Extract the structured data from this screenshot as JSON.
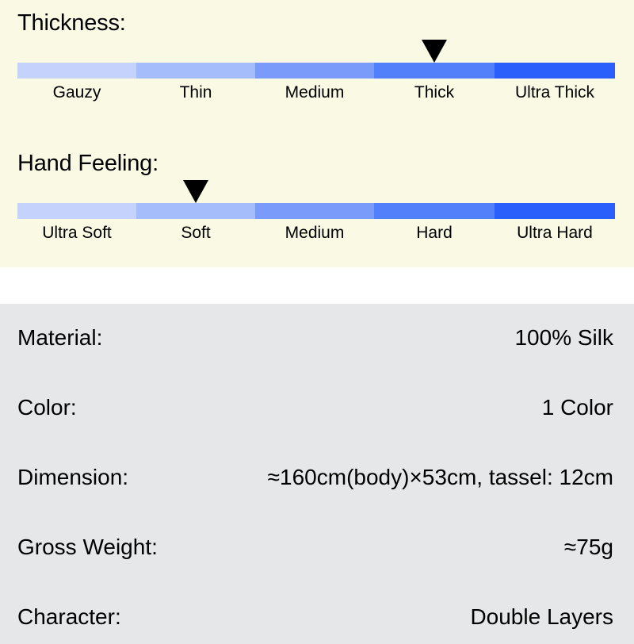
{
  "scales": [
    {
      "id": "thickness",
      "title": "Thickness:",
      "segments": [
        {
          "label": "Gauzy",
          "color": "#c5d2fb"
        },
        {
          "label": "Thin",
          "color": "#a6bdfb"
        },
        {
          "label": "Medium",
          "color": "#7b9bfb"
        },
        {
          "label": "Thick",
          "color": "#5280fa"
        },
        {
          "label": "Ultra Thick",
          "color": "#2a5ffb"
        }
      ],
      "selected_index": 3,
      "selected_label": "Thick",
      "marker_icon": "down-triangle-marker-icon"
    },
    {
      "id": "hand-feeling",
      "title": "Hand Feeling:",
      "segments": [
        {
          "label": "Ultra Soft",
          "color": "#c5d2fb"
        },
        {
          "label": "Soft",
          "color": "#a6bdfb"
        },
        {
          "label": "Medium",
          "color": "#7b9bfb"
        },
        {
          "label": "Hard",
          "color": "#5280fa"
        },
        {
          "label": "Ultra Hard",
          "color": "#2a5ffb"
        }
      ],
      "selected_index": 1,
      "selected_label": "Soft",
      "marker_icon": "down-triangle-marker-icon"
    }
  ],
  "specs": [
    {
      "key": "Material:",
      "value": "100% Silk"
    },
    {
      "key": "Color:",
      "value": "1 Color"
    },
    {
      "key": "Dimension:",
      "value": "≈160cm(body)×53cm, tassel: 12cm"
    },
    {
      "key": "Gross Weight:",
      "value": "≈75g"
    },
    {
      "key": "Character:",
      "value": "Double Layers"
    }
  ],
  "colors": {
    "scales_background": "#f9f9e4",
    "separator_background": "#ffffff",
    "spec_background": "#e6e7e8",
    "text": "#000000",
    "marker": "#000000"
  }
}
